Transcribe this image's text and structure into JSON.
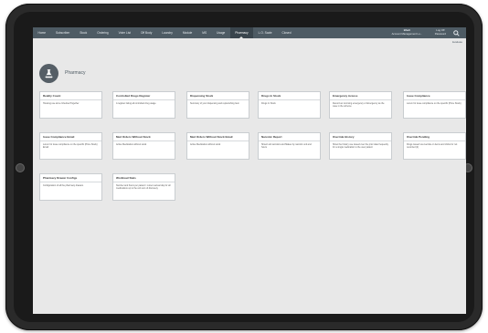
{
  "nav": {
    "items": [
      "Home",
      "Subscriber",
      "Stock",
      "Ordering",
      "Voter List",
      "Off Body",
      "Laundry",
      "Module",
      "MS",
      "Usage",
      "Pharmacy",
      "L.O. Scale",
      "Closed"
    ],
    "active_index": 10,
    "user_name": "Bhatt",
    "user_role": "Account Management Lo...",
    "logout_label": "Log Off",
    "logout_sub": "Password",
    "search_icon": "search-icon",
    "sub_link": "Evaluate"
  },
  "page": {
    "title": "Pharmacy",
    "icon": "flask-icon"
  },
  "cards": [
    {
      "title": "Reality Count",
      "desc": "Housing use since Inherited Together"
    },
    {
      "title": "Controlled Drugs Register",
      "desc": "A register listing all controlled drug usage"
    },
    {
      "title": "Dispensing Stock",
      "desc": "Summary of your dispensing and replenishing Item"
    },
    {
      "title": "Drugs In Stock",
      "desc": "Drugs In Stock"
    },
    {
      "title": "Emergency Access",
      "desc": "Record an incoming emergency or Emergency as the case in the scheme"
    },
    {
      "title": "Issue Compliance",
      "desc": "Lorem for issue compliance on the specific (Price Stock)"
    },
    {
      "title": "Issue Compliance Email",
      "desc": "Lorem for issue compliance on the specific (Price Stock) Email"
    },
    {
      "title": "Med Orders Without Stock",
      "desc": "Active Medication without stock"
    },
    {
      "title": "Med Orders Without Stock Email",
      "desc": "Active Medication without stock"
    },
    {
      "title": "Narcotic Report",
      "desc": "Show's all narcotics and Makes by narcotic unit and hours"
    },
    {
      "title": "Override History",
      "desc": "Show the history use issued over the prior date frequently for a single medication to the user patient"
    },
    {
      "title": "Override Pending",
      "desc": "Drugs issued via override on items and clicks for not recorded (2)"
    },
    {
      "title": "Pharmacy Drawer Configs",
      "desc": "Configuration of all the pharmacy drawers"
    },
    {
      "title": "Workload Stats",
      "desc": "Number and hours per patient / nurse's actual day for all medications up to the unit sum of discovery"
    }
  ]
}
